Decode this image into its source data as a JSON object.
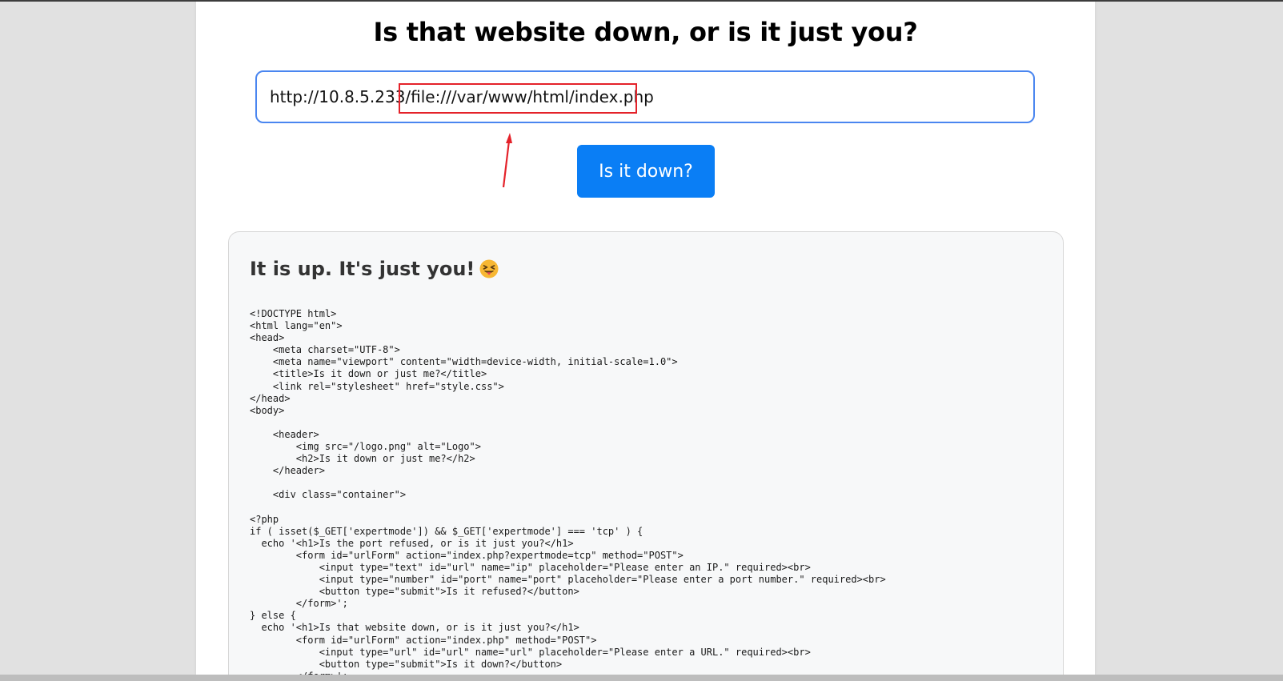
{
  "page": {
    "title": "Is that website down, or is it just you?"
  },
  "form": {
    "url_value": "http://10.8.5.233/file:///var/www/html/index.php",
    "submit_label": "Is it down?"
  },
  "result": {
    "heading": "It is up. It's just you!",
    "emoji": "squinting-face-with-tongue-icon",
    "source_lines": [
      "<!DOCTYPE html>",
      "<html lang=\"en\">",
      "<head>",
      "    <meta charset=\"UTF-8\">",
      "    <meta name=\"viewport\" content=\"width=device-width, initial-scale=1.0\">",
      "    <title>Is it down or just me?</title>",
      "    <link rel=\"stylesheet\" href=\"style.css\">",
      "</head>",
      "<body>",
      "",
      "    <header>",
      "        <img src=\"/logo.png\" alt=\"Logo\">",
      "        <h2>Is it down or just me?</h2>",
      "    </header>",
      "",
      "    <div class=\"container\">",
      "",
      "<?php",
      "if ( isset($_GET['expertmode']) && $_GET['expertmode'] === 'tcp' ) {",
      "  echo '<h1>Is the port refused, or is it just you?</h1>",
      "        <form id=\"urlForm\" action=\"index.php?expertmode=tcp\" method=\"POST\">",
      "            <input type=\"text\" id=\"url\" name=\"ip\" placeholder=\"Please enter an IP.\" required><br>",
      "            <input type=\"number\" id=\"port\" name=\"port\" placeholder=\"Please enter a port number.\" required><br>",
      "            <button type=\"submit\">Is it refused?</button>",
      "        </form>';",
      "} else {",
      "  echo '<h1>Is that website down, or is it just you?</h1>",
      "        <form id=\"urlForm\" action=\"index.php\" method=\"POST\">",
      "            <input type=\"url\" id=\"url\" name=\"url\" placeholder=\"Please enter a URL.\" required><br>",
      "            <button type=\"submit\">Is it down?</button>",
      "        </form>';"
    ]
  },
  "colors": {
    "accent": "#0a7ef5",
    "input_border": "#4a86f0",
    "annotation": "#e4222a",
    "panel_bg": "#f7f8f9"
  }
}
